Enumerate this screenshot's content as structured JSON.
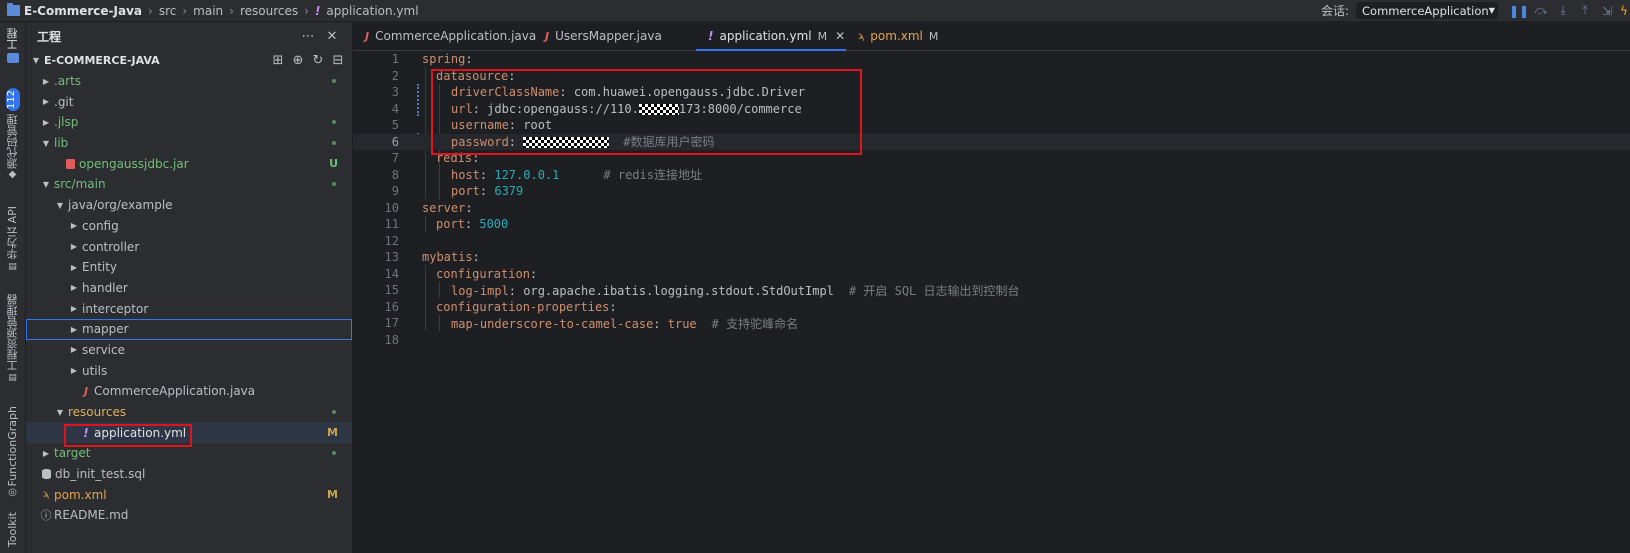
{
  "breadcrumb": {
    "project": "E-Commerce-Java",
    "parts": [
      "src",
      "main",
      "resources"
    ],
    "file": "application.yml"
  },
  "run": {
    "session_label": "会话:",
    "config": "CommerceApplication"
  },
  "stripe": {
    "project_tool": "工程",
    "vcs_badge": "112",
    "vcs_tool": "源代码管理",
    "huawei_api": "华为云 API",
    "resource_mgr": "工程资源管理器",
    "function_graph": "FunctionGraph",
    "toolkit": "Toolkit"
  },
  "project_panel": {
    "title": "工程",
    "root": "E-COMMERCE-JAVA",
    "items": [
      {
        "label": ".arts",
        "status": "dot"
      },
      {
        "label": ".git",
        "status": ""
      },
      {
        "label": ".jlsp",
        "status": "dot"
      },
      {
        "label": "lib",
        "status": "dot"
      },
      {
        "label": "opengaussjdbc.jar",
        "status": "U"
      },
      {
        "label": "src/main",
        "status": "dot"
      },
      {
        "label": "java/org/example",
        "status": ""
      },
      {
        "label": "config",
        "status": ""
      },
      {
        "label": "controller",
        "status": ""
      },
      {
        "label": "Entity",
        "status": ""
      },
      {
        "label": "handler",
        "status": ""
      },
      {
        "label": "interceptor",
        "status": ""
      },
      {
        "label": "mapper",
        "status": ""
      },
      {
        "label": "service",
        "status": ""
      },
      {
        "label": "utils",
        "status": ""
      },
      {
        "label": "CommerceApplication.java",
        "status": ""
      },
      {
        "label": "resources",
        "status": "dot"
      },
      {
        "label": "application.yml",
        "status": "M"
      },
      {
        "label": "target",
        "status": "dot"
      },
      {
        "label": "db_init_test.sql",
        "status": ""
      },
      {
        "label": "pom.xml",
        "status": "M"
      },
      {
        "label": "README.md",
        "status": ""
      }
    ]
  },
  "tabs": [
    {
      "label": "CommerceApplication.java",
      "modified": ""
    },
    {
      "label": "UsersMapper.java",
      "modified": ""
    },
    {
      "label": "application.yml",
      "modified": "M"
    },
    {
      "label": "pom.xml",
      "modified": "M"
    }
  ],
  "editor": {
    "lines": [
      {
        "n": "1",
        "key": "spring",
        "sep": ":",
        "val": "",
        "cmt": ""
      },
      {
        "n": "2",
        "key": "datasource",
        "sep": ":",
        "val": "",
        "cmt": ""
      },
      {
        "n": "3",
        "key": "driverClassName",
        "sep": ": ",
        "val": "com.huawei.opengauss.jdbc.Driver",
        "cmt": ""
      },
      {
        "n": "4",
        "key": "url",
        "sep": ": ",
        "val_pre": "jdbc:opengauss://110.",
        "val_post": "173:8000/commerce",
        "cmt": ""
      },
      {
        "n": "5",
        "key": "username",
        "sep": ": ",
        "val": "root",
        "cmt": ""
      },
      {
        "n": "6",
        "key": "password",
        "sep": ": ",
        "val": "",
        "cmt": "#数据库用户密码"
      },
      {
        "n": "7",
        "key": "redis",
        "sep": ":",
        "val": "",
        "cmt": ""
      },
      {
        "n": "8",
        "key": "host",
        "sep": ": ",
        "val": "127.0.0.1",
        "cmt": "# redis连接地址"
      },
      {
        "n": "9",
        "key": "port",
        "sep": ": ",
        "val": "6379",
        "cmt": ""
      },
      {
        "n": "10",
        "key": "server",
        "sep": ":",
        "val": "",
        "cmt": ""
      },
      {
        "n": "11",
        "key": "port",
        "sep": ": ",
        "val": "5000",
        "cmt": ""
      },
      {
        "n": "12",
        "key": "",
        "sep": "",
        "val": "",
        "cmt": ""
      },
      {
        "n": "13",
        "key": "mybatis",
        "sep": ":",
        "val": "",
        "cmt": ""
      },
      {
        "n": "14",
        "key": "configuration",
        "sep": ":",
        "val": "",
        "cmt": ""
      },
      {
        "n": "15",
        "key": "log-impl",
        "sep": ": ",
        "val": "org.apache.ibatis.logging.stdout.StdOutImpl",
        "cmt": "# 开启 SQL 日志输出到控制台"
      },
      {
        "n": "16",
        "key": "configuration-properties",
        "sep": ":",
        "val": "",
        "cmt": ""
      },
      {
        "n": "17",
        "key": "map-underscore-to-camel-case",
        "sep": ": ",
        "val": "true",
        "cmt": "# 支持驼峰命名"
      },
      {
        "n": "18",
        "key": "",
        "sep": "",
        "val": "",
        "cmt": ""
      }
    ]
  }
}
